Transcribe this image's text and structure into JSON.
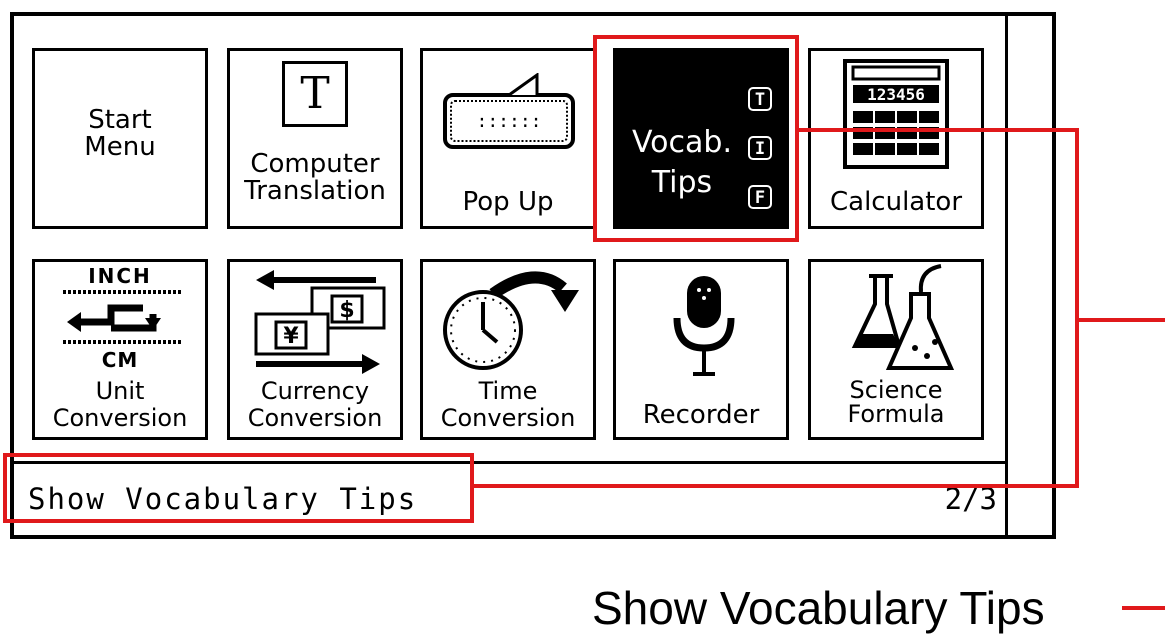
{
  "apps": {
    "row1": [
      {
        "label": "Start\nMenu",
        "icon": "start-menu"
      },
      {
        "label": "Computer\nTranslation",
        "icon": "letter-t-icon"
      },
      {
        "label": "Pop Up",
        "icon": "speech-bubble-icon"
      },
      {
        "label": "Vocab.\nTips",
        "icon": "vocab-tips-icon",
        "badges": [
          "T",
          "I",
          "F"
        ],
        "selected": true
      },
      {
        "label": "Calculator",
        "icon": "calculator-icon",
        "display": "123456"
      }
    ],
    "row2": [
      {
        "label": "Unit\nConversion",
        "icon": "unit-conversion-icon",
        "top": "INCH",
        "bottom": "CM"
      },
      {
        "label": "Currency\nConversion",
        "icon": "currency-icon",
        "symbols": [
          "¥",
          "$"
        ]
      },
      {
        "label": "Time\nConversion",
        "icon": "clock-icon"
      },
      {
        "label": "Recorder",
        "icon": "microphone-icon"
      },
      {
        "label": "Science\nFormula",
        "icon": "flask-icon"
      }
    ]
  },
  "status": {
    "text": "Show Vocabulary Tips",
    "page": "2/3"
  },
  "caption": "Show Vocabulary Tips",
  "colors": {
    "highlight": "#e0191b",
    "ink": "#000000",
    "background": "#ffffff"
  }
}
